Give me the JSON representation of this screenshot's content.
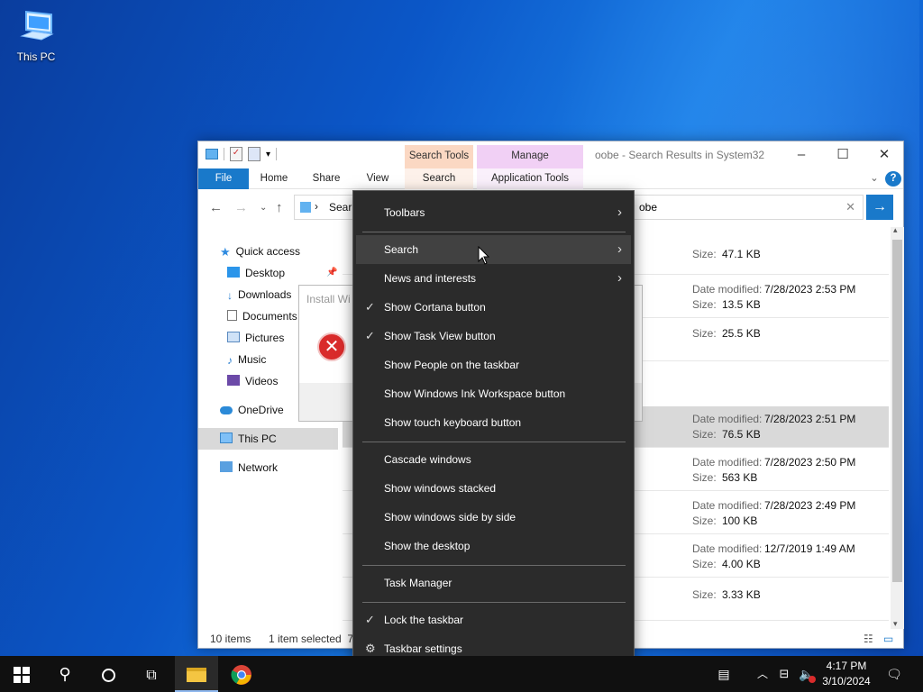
{
  "desktop": {
    "this_pc_label": "This PC"
  },
  "explorer": {
    "window_title": "oobe - Search Results in System32",
    "context_tabs": {
      "search_tools": "Search Tools",
      "manage": "Manage"
    },
    "ribbon_tabs": [
      "File",
      "Home",
      "Share",
      "View",
      "Search",
      "Application Tools"
    ],
    "address_text": "Sear",
    "search_value": "obe",
    "sidebar": [
      "Quick access",
      "Desktop",
      "Downloads",
      "Documents",
      "Pictures",
      "Music",
      "Videos",
      "OneDrive",
      "This PC",
      "Network"
    ],
    "rows": [
      {
        "dm_label": "",
        "dm_value": "",
        "size_label": "Size:",
        "size_value": "47.1 KB"
      },
      {
        "dm_label": "Date modified:",
        "dm_value": "7/28/2023 2:53 PM",
        "size_label": "Size:",
        "size_value": "13.5 KB"
      },
      {
        "dm_label": "",
        "dm_value": "",
        "size_label": "Size:",
        "size_value": "25.5 KB"
      },
      {
        "dm_label": "Date modified:",
        "dm_value": "7/28/2023 2:51 PM",
        "size_label": "Size:",
        "size_value": "76.5 KB"
      },
      {
        "dm_label": "Date modified:",
        "dm_value": "7/28/2023 2:50 PM",
        "size_label": "Size:",
        "size_value": "563 KB"
      },
      {
        "dm_label": "Date modified:",
        "dm_value": "7/28/2023 2:49 PM",
        "size_label": "Size:",
        "size_value": "100 KB"
      },
      {
        "dm_label": "Date modified:",
        "dm_value": "12/7/2019 1:49 AM",
        "size_label": "Size:",
        "size_value": "4.00 KB"
      },
      {
        "dm_label": "",
        "dm_value": "",
        "size_label": "Size:",
        "size_value": "3.33 KB"
      }
    ],
    "status": {
      "items": "10 items",
      "selected": "1 item selected  76"
    },
    "dialog_title": "Install Wi"
  },
  "menu": {
    "items": [
      {
        "label": "Toolbars",
        "arrow": true
      },
      {
        "label": "Search",
        "arrow": true
      },
      {
        "label": "News and interests",
        "arrow": true
      },
      {
        "label": "Show Cortana button",
        "checked": true
      },
      {
        "label": "Show Task View button",
        "checked": true
      },
      {
        "label": "Show People on the taskbar"
      },
      {
        "label": "Show Windows Ink Workspace button"
      },
      {
        "label": "Show touch keyboard button"
      },
      {
        "label": "Cascade windows"
      },
      {
        "label": "Show windows stacked"
      },
      {
        "label": "Show windows side by side"
      },
      {
        "label": "Show the desktop"
      },
      {
        "label": "Task Manager"
      },
      {
        "label": "Lock the taskbar",
        "checked": true
      },
      {
        "label": "Taskbar settings",
        "icon": "gear-icon"
      }
    ],
    "highlighted": "Search"
  },
  "taskbar": {
    "time": "4:17 PM",
    "date": "3/10/2024"
  },
  "colors": {
    "accent": "#1979ca",
    "menu_bg": "#2b2b2b",
    "menu_hover": "#414141",
    "taskbar": "#101010"
  }
}
